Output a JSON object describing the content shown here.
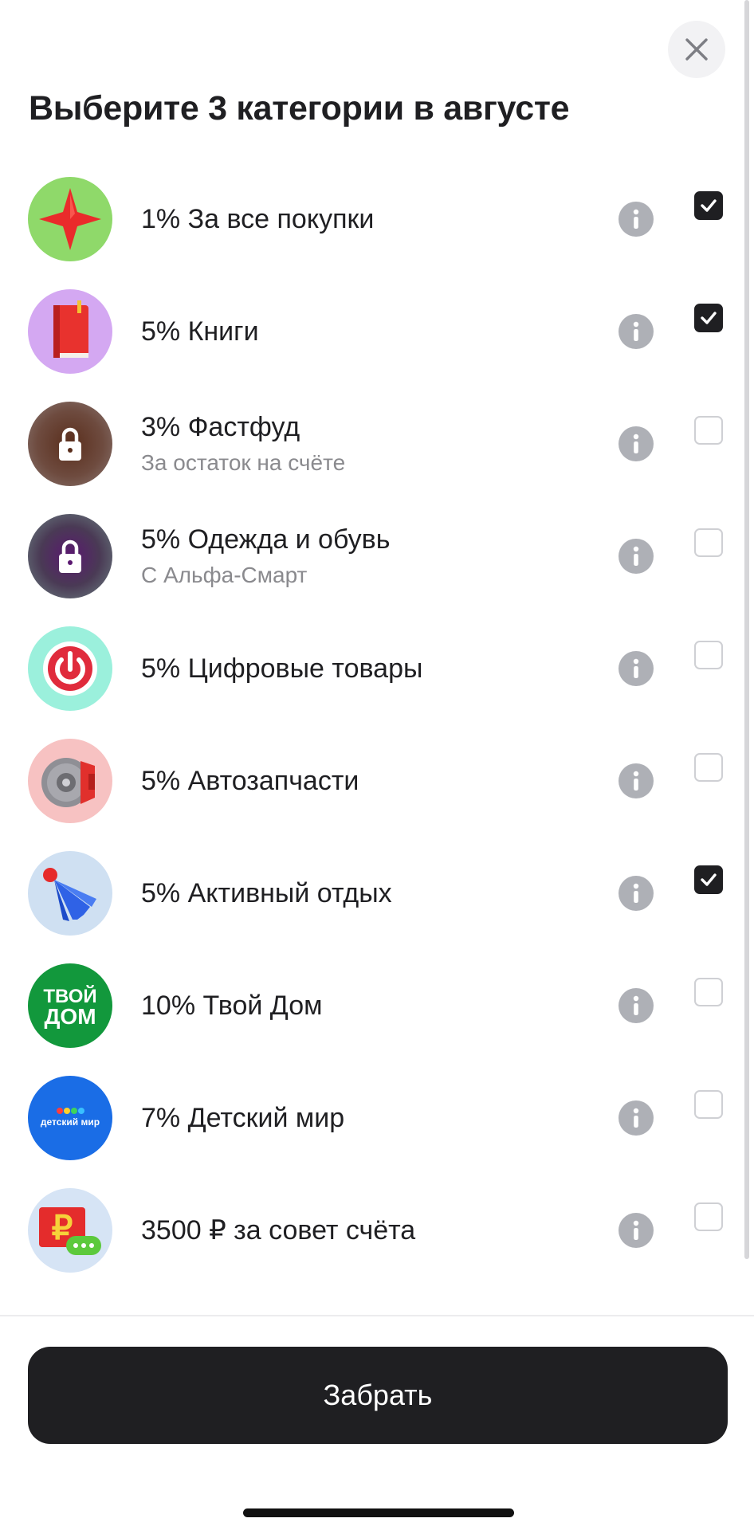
{
  "dialog": {
    "title": "Выберите 3 категории в августе",
    "close_icon": "close-icon"
  },
  "categories": [
    {
      "label": "1% За все покупки",
      "subtitle": "",
      "icon": "star-icon",
      "checked": true
    },
    {
      "label": "5% Книги",
      "subtitle": "",
      "icon": "book-icon",
      "checked": true
    },
    {
      "label": "3% Фастфуд",
      "subtitle": "За остаток на счёте",
      "icon": "lock-icon",
      "checked": false
    },
    {
      "label": "5% Одежда и обувь",
      "subtitle": "С Альфа-Смарт",
      "icon": "lock-icon",
      "checked": false
    },
    {
      "label": "5% Цифровые товары",
      "subtitle": "",
      "icon": "power-icon",
      "checked": false
    },
    {
      "label": "5% Автозапчасти",
      "subtitle": "",
      "icon": "brake-disc-icon",
      "checked": false
    },
    {
      "label": "5% Активный отдых",
      "subtitle": "",
      "icon": "shuttlecock-icon",
      "checked": true
    },
    {
      "label": "10% Твой Дом",
      "subtitle": "",
      "icon": "tvoy-dom-logo",
      "logo_text": [
        "ТВОЙ",
        "ДОМ"
      ],
      "checked": false
    },
    {
      "label": "7% Детский мир",
      "subtitle": "",
      "icon": "detskiy-mir-logo",
      "logo_text": [
        "детский мир"
      ],
      "checked": false
    },
    {
      "label": "3500 ₽ за совет счёта",
      "subtitle": "",
      "icon": "ruble-card-icon",
      "checked": false
    }
  ],
  "footer": {
    "submit_label": "Забрать"
  },
  "colors": {
    "primary_dark": "#1f1f22",
    "secondary_text": "#8a8a8e",
    "info_gray": "#aeb0b6"
  }
}
